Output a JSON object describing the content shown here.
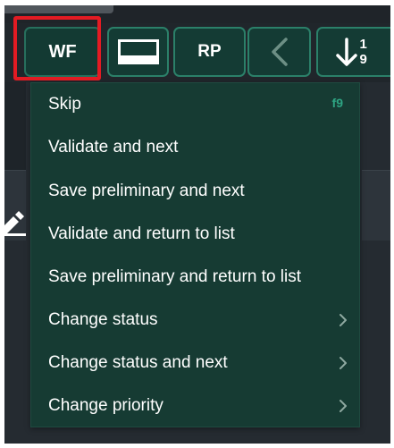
{
  "toolbar": {
    "wf_label": "WF",
    "rp_label": "RP",
    "sort_digit_top": "1",
    "sort_digit_bottom": "9"
  },
  "icons": {
    "view": "layout-view-icon",
    "back": "chevron-left-icon",
    "sort": "sort-ascending-icon",
    "edit": "pencil-icon",
    "submenu": "chevron-right-icon"
  },
  "colors": {
    "menu_background": "#163b33",
    "toolbar_button": "#143b34",
    "toolbar_border": "#2b8069",
    "shortcut_accent": "#2ea483",
    "highlight": "#e31b23"
  },
  "menu": {
    "items": [
      {
        "label": "Skip",
        "shortcut": "f9",
        "has_submenu": false
      },
      {
        "label": "Validate and next",
        "shortcut": "",
        "has_submenu": false
      },
      {
        "label": "Save preliminary and next",
        "shortcut": "",
        "has_submenu": false
      },
      {
        "label": "Validate and return to list",
        "shortcut": "",
        "has_submenu": false
      },
      {
        "label": "Save preliminary and return to list",
        "shortcut": "",
        "has_submenu": false
      },
      {
        "label": "Change status",
        "shortcut": "",
        "has_submenu": true
      },
      {
        "label": "Change status and next",
        "shortcut": "",
        "has_submenu": true
      },
      {
        "label": "Change priority",
        "shortcut": "",
        "has_submenu": true
      }
    ]
  }
}
